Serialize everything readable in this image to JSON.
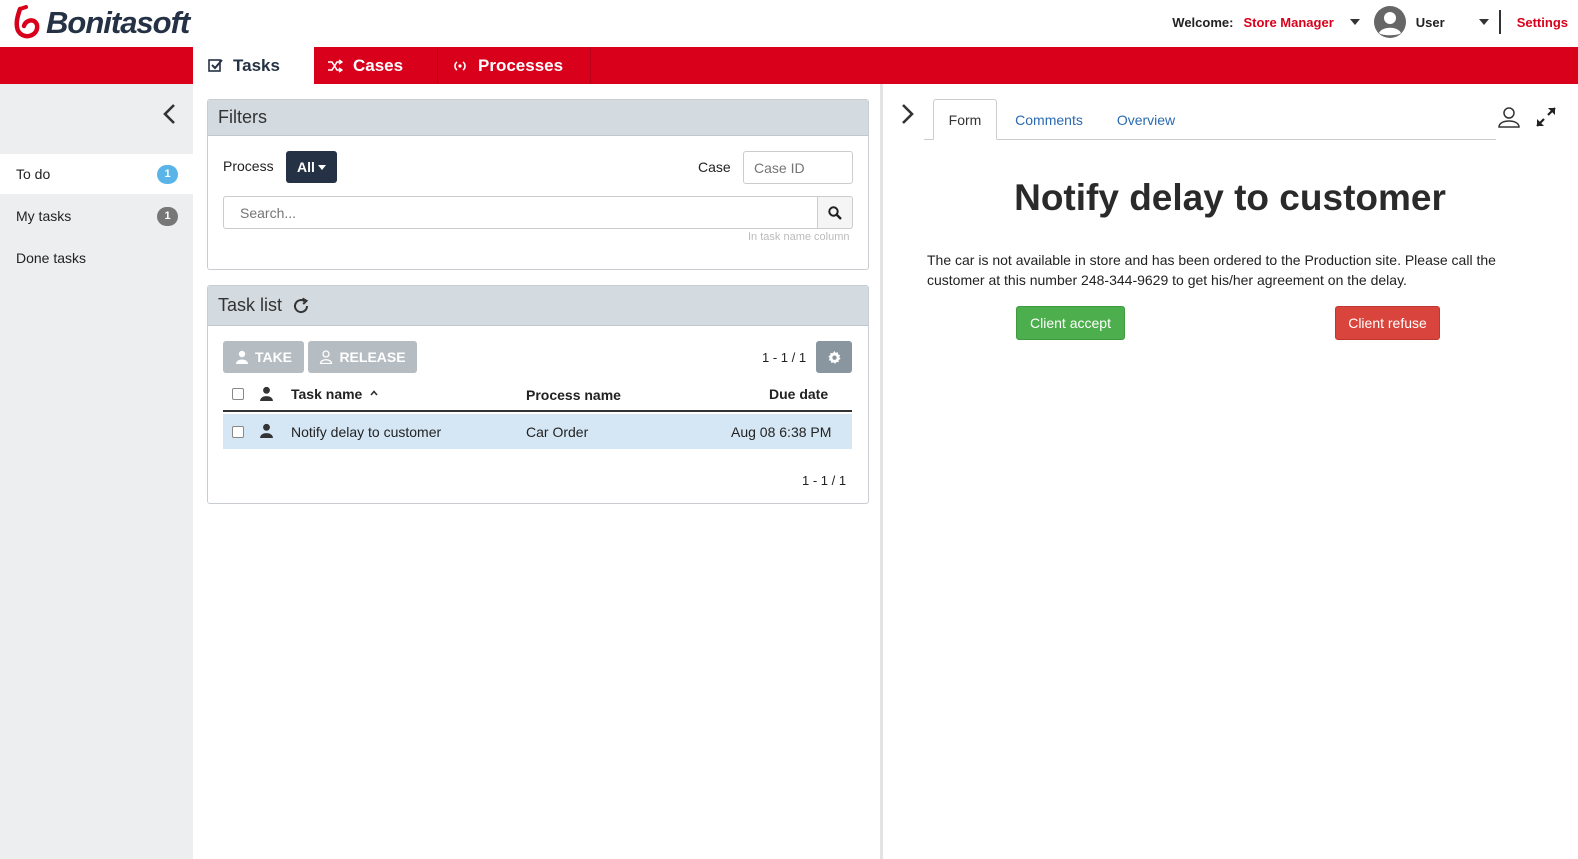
{
  "header": {
    "logo_text": "Bonitasoft",
    "welcome_label": "Welcome:",
    "profile_name": "Store Manager",
    "user_label": "User",
    "settings_label": "Settings",
    "accent_color": "#d9001b",
    "dark_color": "#253245"
  },
  "nav": {
    "tabs": [
      {
        "label": "Tasks",
        "icon": "check-square-icon",
        "active": true
      },
      {
        "label": "Cases",
        "icon": "shuffle-icon",
        "active": false
      },
      {
        "label": "Processes",
        "icon": "process-icon",
        "active": false
      }
    ]
  },
  "sidebar": {
    "items": [
      {
        "label": "To do",
        "badge": "1",
        "active": true
      },
      {
        "label": "My tasks",
        "badge": "1",
        "active": false
      },
      {
        "label": "Done tasks",
        "badge": "",
        "active": false
      }
    ]
  },
  "filters": {
    "title": "Filters",
    "process_label": "Process",
    "process_value": "All",
    "case_label": "Case",
    "case_placeholder": "Case ID",
    "search_placeholder": "Search...",
    "search_hint": "In task name column"
  },
  "tasklist": {
    "title": "Task list",
    "take_label": "TAKE",
    "release_label": "RELEASE",
    "pagination_top": "1 - 1 / 1",
    "pagination_bottom": "1 - 1 / 1",
    "columns": [
      "Task name",
      "Process name",
      "Due date"
    ],
    "rows": [
      {
        "task_name": "Notify delay to customer",
        "process_name": "Car Order",
        "due_date": "Aug 08 6:38 PM"
      }
    ]
  },
  "detail": {
    "tabs": [
      "Form",
      "Comments",
      "Overview"
    ],
    "form_title": "Notify delay to customer",
    "form_description": "The car is not available in store and has been ordered to the Production site. Please call the customer at this number 248-344-9629 to get his/her agreement on the delay.",
    "accept_label": "Client accept",
    "refuse_label": "Client refuse"
  }
}
